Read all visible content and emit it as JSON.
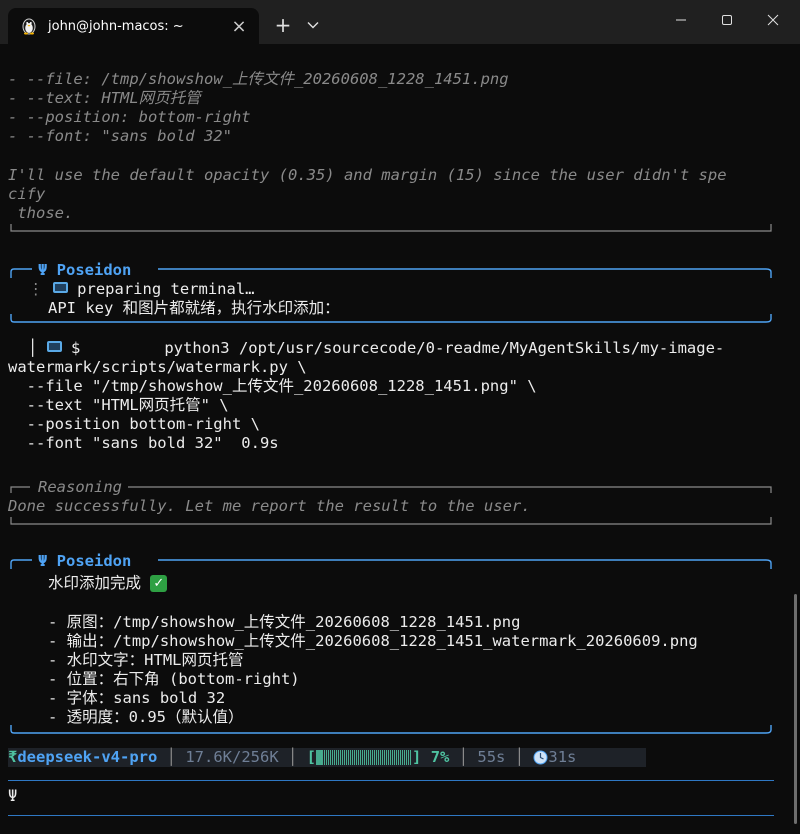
{
  "window": {
    "tab_title": "john@john-macos: ~",
    "close_glyph": "×",
    "newtab_glyph": "+"
  },
  "colors": {
    "background": "#0c0c0c",
    "titlebar": "#202020",
    "accent": "#4fa3f4",
    "dim_text": "#8a8a8a",
    "status_green": "#4fc3a1"
  },
  "icons": {
    "tab": "penguin-icon",
    "laptop": "laptop-icon",
    "check": "check-mark-icon"
  },
  "transcript": {
    "params": [
      "- --file: /tmp/showshow_上传文件_20260608_1228_1451.png",
      "- --text: HTML网页托管",
      "- --position: bottom-right",
      "- --font: \"sans bold 32\""
    ],
    "note_lines": [
      "I'll use the default opacity (0.35) and margin (15) since the user didn't spe",
      "cify",
      " those."
    ],
    "block1": {
      "header": "Ψ Poseidon",
      "status_prefix": "⋮ ",
      "status": " preparing terminal…",
      "message": "API key 和图片都就绪，执行水印添加："
    },
    "command": {
      "prefix": "│ ",
      "prompt": " $         python3 /opt/usr/sourcecode/0-readme/MyAgentSkills/my-image-",
      "lines": [
        "watermark/scripts/watermark.py \\",
        "  --file \"/tmp/showshow_上传文件_20260608_1228_1451.png\" \\",
        "  --text \"HTML网页托管\" \\",
        "  --position bottom-right \\",
        "  --font \"sans bold 32\"  0.9s"
      ]
    },
    "reasoning": {
      "label": "Reasoning",
      "text": "Done successfully. Let me report the result to the user."
    },
    "block2": {
      "header": "Ψ Poseidon",
      "title": "水印添加完成 ",
      "items": [
        "- 原图：/tmp/showshow_上传文件_20260608_1228_1451.png",
        "- 输出：/tmp/showshow_上传文件_20260608_1228_1451_watermark_20260609.png",
        "- 水印文字：HTML网页托管",
        "- 位置：右下角 (bottom-right)",
        "- 字体：sans bold 32",
        "- 透明度：0.95（默认值）"
      ]
    }
  },
  "statusbar": {
    "model": "deepseek-v4-pro",
    "tokens": "17.6K/256K",
    "progress_open": "[",
    "progress_close": "]",
    "progress_percent": "7%",
    "progress_fraction": 0.07,
    "elapsed": "55s",
    "timer": "31s",
    "separator": " │ "
  },
  "prompt": {
    "symbol": "Ψ"
  }
}
